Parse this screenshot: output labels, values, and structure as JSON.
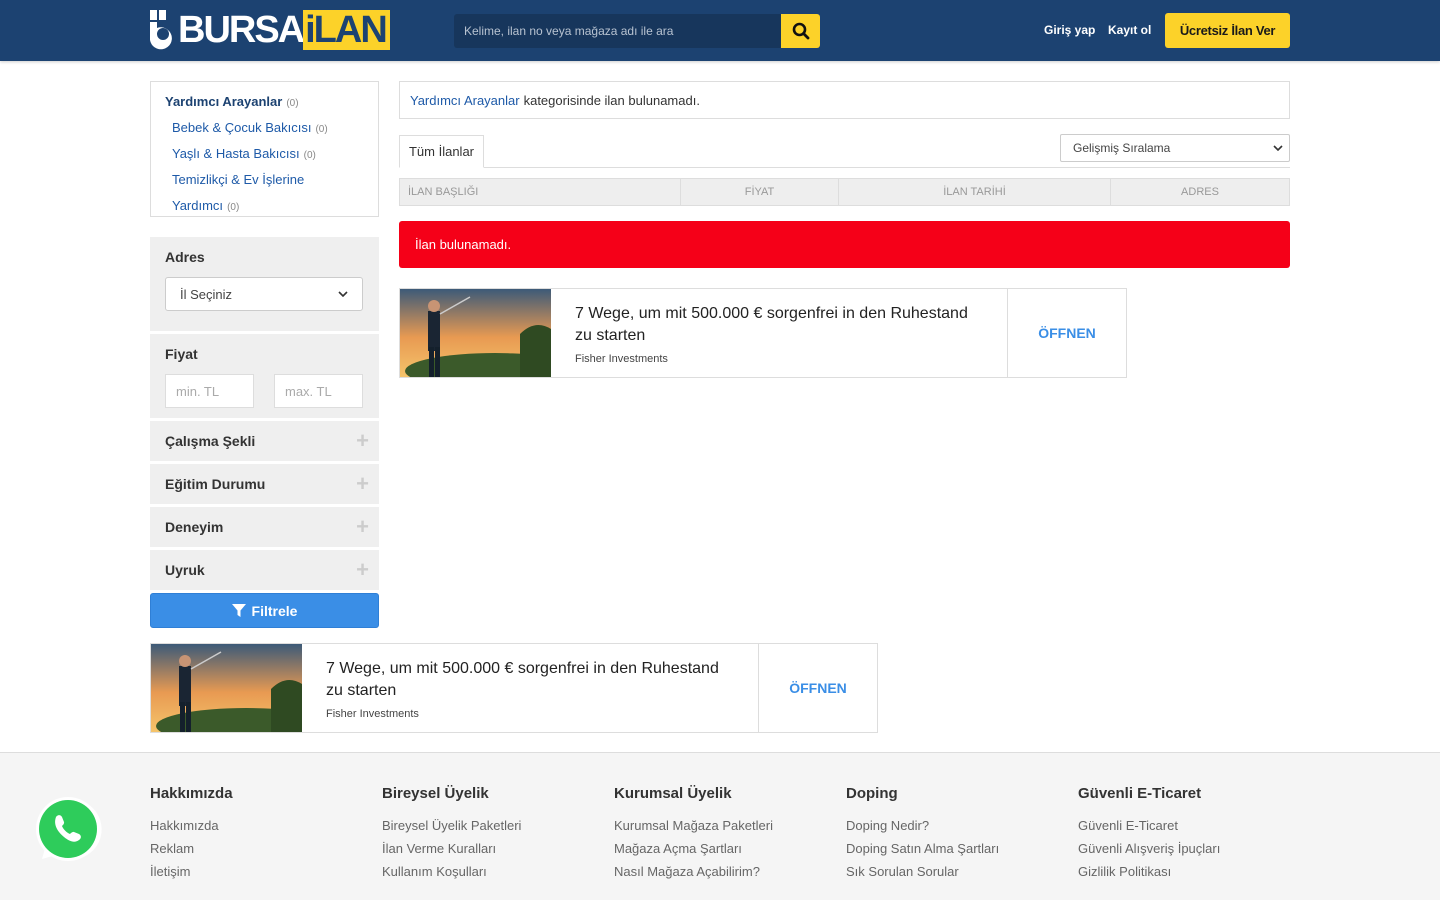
{
  "header": {
    "logo_left": "BURSA",
    "logo_right": "iLAN",
    "search_placeholder": "Kelime, ilan no veya mağaza adı ile ara",
    "login": "Giriş yap",
    "register": "Kayıt ol",
    "cta": "Ücretsiz İlan Ver",
    "accent": "#fcd229",
    "brand": "#1c4271"
  },
  "categories": {
    "main": {
      "label": "Yardımcı Arayanlar",
      "count": "(0)"
    },
    "subs": [
      {
        "label": "Bebek & Çocuk Bakıcısı",
        "count": "(0)"
      },
      {
        "label": "Yaşlı & Hasta Bakıcısı",
        "count": "(0)"
      },
      {
        "label": "Temizlikçi & Ev İşlerine",
        "count": ""
      },
      {
        "label": "Yardımcı",
        "count": "(0)"
      }
    ]
  },
  "filters": {
    "address_title": "Adres",
    "address_select": "İl Seçiniz",
    "price_title": "Fiyat",
    "price_min_placeholder": "min. TL",
    "price_max_placeholder": "max. TL",
    "collapsibles": [
      "Çalışma Şekli",
      "Eğitim Durumu",
      "Deneyim",
      "Uyruk"
    ],
    "filter_button": "Filtrele"
  },
  "main": {
    "notice_link": "Yardımcı Arayanlar",
    "notice_text": "kategorisinde ilan bulunamadı.",
    "tab_all": "Tüm İlanlar",
    "sort_label": "Gelişmiş Sıralama",
    "columns": [
      "İLAN BAŞLIĞI",
      "FİYAT",
      "İLAN TARİHİ",
      "ADRES"
    ],
    "alert": "İlan bulunamadı.",
    "alert_color": "#f50018"
  },
  "ad": {
    "title": "7 Wege, um mit 500.000 € sorgenfrei in den Ruhestand zu starten",
    "sponsor": "Fisher Investments",
    "cta": "ÖFFNEN"
  },
  "footer": {
    "columns": [
      {
        "title": "Hakkımızda",
        "links": [
          "Hakkımızda",
          "Reklam",
          "İletişim"
        ]
      },
      {
        "title": "Bireysel Üyelik",
        "links": [
          "Bireysel Üyelik Paketleri",
          "İlan Verme Kuralları",
          "Kullanım Koşulları"
        ]
      },
      {
        "title": "Kurumsal Üyelik",
        "links": [
          "Kurumsal Mağaza Paketleri",
          "Mağaza Açma Şartları",
          "Nasıl Mağaza Açabilirim?"
        ]
      },
      {
        "title": "Doping",
        "links": [
          "Doping Nedir?",
          "Doping Satın Alma Şartları",
          "Sık Sorulan Sorular"
        ]
      },
      {
        "title": "Güvenli E-Ticaret",
        "links": [
          "Güvenli E-Ticaret",
          "Güvenli Alışveriş İpuçları",
          "Gizlilik Politikası"
        ]
      }
    ]
  }
}
